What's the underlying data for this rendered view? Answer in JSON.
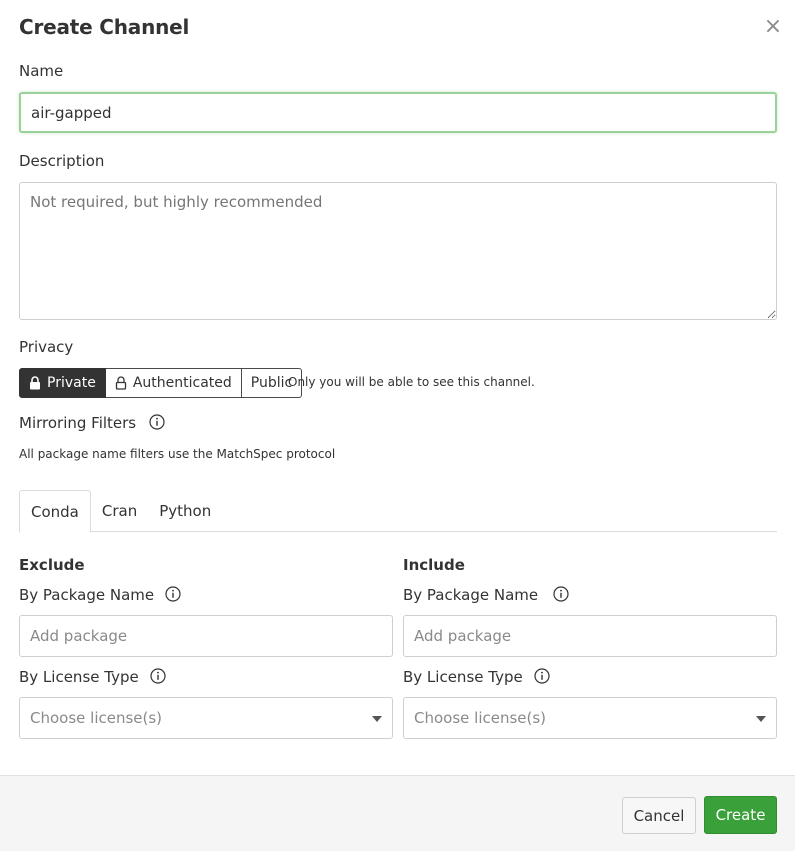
{
  "dialog": {
    "title": "Create Channel",
    "close_symbol": "×"
  },
  "name": {
    "label": "Name",
    "value": "air-gapped"
  },
  "description": {
    "label": "Description",
    "placeholder": "Not required, but highly recommended"
  },
  "privacy": {
    "label": "Privacy",
    "options": [
      {
        "label": "Private",
        "icon": "lock-closed-icon",
        "selected": true
      },
      {
        "label": "Authenticated",
        "icon": "lock-open-icon",
        "selected": false
      },
      {
        "label": "Public",
        "selected": false
      }
    ],
    "note": "Only you will be able to see this channel."
  },
  "mirroring": {
    "label": "Mirroring Filters",
    "hint": "All package name filters use the MatchSpec protocol",
    "tabs": [
      "Conda",
      "Cran",
      "Python"
    ],
    "active_tab": "Conda"
  },
  "exclude": {
    "heading": "Exclude",
    "package_label": "By Package Name",
    "package_placeholder": "Add package",
    "license_label": "By License Type",
    "license_placeholder": "Choose license(s)"
  },
  "include": {
    "heading": "Include",
    "package_label": "By Package Name",
    "package_placeholder": "Add package",
    "license_label": "By License Type",
    "license_placeholder": "Choose license(s)"
  },
  "footer": {
    "cancel_label": "Cancel",
    "create_label": "Create"
  },
  "colors": {
    "primary": "#3aa03a",
    "active_toggle": "#333333",
    "focus_border": "#9ad29a"
  }
}
